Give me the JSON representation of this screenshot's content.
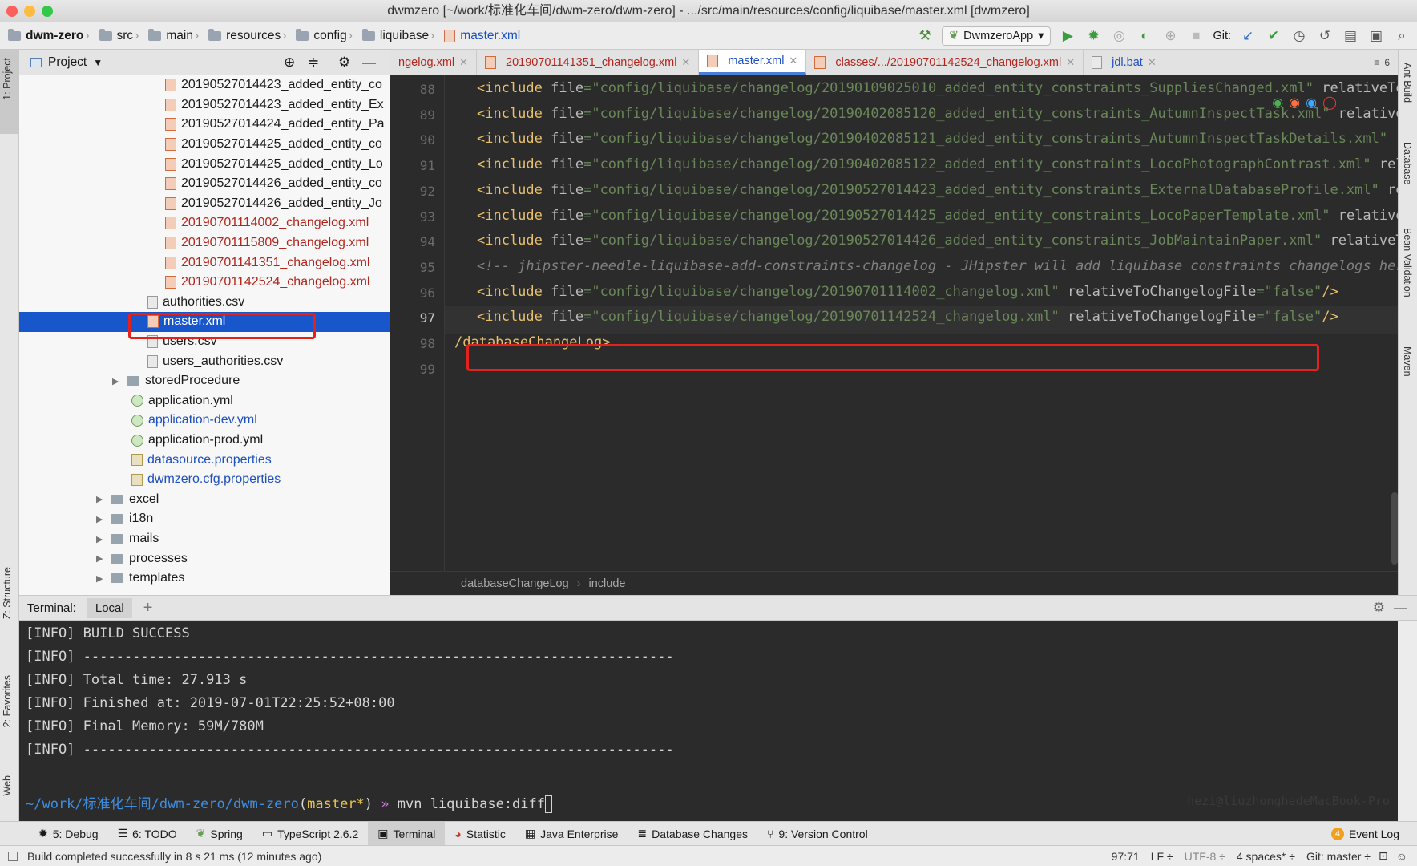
{
  "window": {
    "title": "dwmzero [~/work/标准化车间/dwm-zero/dwm-zero] - .../src/main/resources/config/liquibase/master.xml [dwmzero]"
  },
  "breadcrumb": [
    "dwm-zero",
    "src",
    "main",
    "resources",
    "config",
    "liquibase",
    "master.xml"
  ],
  "toolbar": {
    "run_config": "DwmzeroApp",
    "git_label": "Git:"
  },
  "left_strip": {
    "project": "1: Project",
    "structure": "Z: Structure",
    "favorites": "2: Favorites",
    "web": "Web"
  },
  "right_strip": {
    "ant": "Ant Build",
    "database": "Database",
    "bean": "Bean Validation",
    "maven": "Maven"
  },
  "project_panel": {
    "title": "Project",
    "items": [
      {
        "label": "20190527014423_added_entity_co",
        "kind": "xml",
        "color": "normal"
      },
      {
        "label": "20190527014423_added_entity_Ex",
        "kind": "xml",
        "color": "normal"
      },
      {
        "label": "20190527014424_added_entity_Pa",
        "kind": "xml",
        "color": "normal"
      },
      {
        "label": "20190527014425_added_entity_co",
        "kind": "xml",
        "color": "normal"
      },
      {
        "label": "20190527014425_added_entity_Lo",
        "kind": "xml",
        "color": "normal"
      },
      {
        "label": "20190527014426_added_entity_co",
        "kind": "xml",
        "color": "normal"
      },
      {
        "label": "20190527014426_added_entity_Jo",
        "kind": "xml",
        "color": "normal"
      },
      {
        "label": "20190701114002_changelog.xml",
        "kind": "xml",
        "color": "red"
      },
      {
        "label": "20190701115809_changelog.xml",
        "kind": "xml",
        "color": "red"
      },
      {
        "label": "20190701141351_changelog.xml",
        "kind": "xml",
        "color": "red"
      },
      {
        "label": "20190701142524_changelog.xml",
        "kind": "xml",
        "color": "red"
      },
      {
        "label": "authorities.csv",
        "kind": "csv",
        "color": "normal"
      },
      {
        "label": "master.xml",
        "kind": "xml",
        "color": "selected"
      },
      {
        "label": "users.csv",
        "kind": "csv",
        "color": "normal"
      },
      {
        "label": "users_authorities.csv",
        "kind": "csv",
        "color": "normal"
      },
      {
        "label": "storedProcedure",
        "kind": "folder",
        "color": "normal"
      },
      {
        "label": "application.yml",
        "kind": "yml",
        "color": "normal"
      },
      {
        "label": "application-dev.yml",
        "kind": "yml",
        "color": "blue"
      },
      {
        "label": "application-prod.yml",
        "kind": "yml",
        "color": "normal"
      },
      {
        "label": "datasource.properties",
        "kind": "prop",
        "color": "blue"
      },
      {
        "label": "dwmzero.cfg.properties",
        "kind": "prop",
        "color": "blue"
      },
      {
        "label": "excel",
        "kind": "folder",
        "color": "normal"
      },
      {
        "label": "i18n",
        "kind": "folder",
        "color": "normal"
      },
      {
        "label": "mails",
        "kind": "folder",
        "color": "normal"
      },
      {
        "label": "processes",
        "kind": "folder",
        "color": "normal"
      },
      {
        "label": "templates",
        "kind": "folder",
        "color": "normal"
      }
    ]
  },
  "tabs": [
    {
      "label": "ngelog.xml",
      "active": false
    },
    {
      "label": "20190701141351_changelog.xml",
      "active": false
    },
    {
      "label": "master.xml",
      "active": true
    },
    {
      "label": "classes/.../20190701142524_changelog.xml",
      "active": false
    },
    {
      "label": "jdl.bat",
      "active": false
    }
  ],
  "tab_overflow": "6",
  "editor": {
    "line_numbers": [
      "88",
      "89",
      "90",
      "91",
      "92",
      "93",
      "94",
      "95",
      "96",
      "97",
      "98",
      "99"
    ],
    "current_line": "97",
    "lines": [
      {
        "type": "include",
        "file": "config/liquibase/changelog/20190109025010_added_entity_constraints_SuppliesChanged.xml",
        "attr": "relativeToChan"
      },
      {
        "type": "include",
        "file": "config/liquibase/changelog/20190402085120_added_entity_constraints_AutumnInspectTask.xml",
        "attr": "relativeToCh"
      },
      {
        "type": "include",
        "file": "config/liquibase/changelog/20190402085121_added_entity_constraints_AutumnInspectTaskDetails.xml",
        "attr": "rela"
      },
      {
        "type": "include",
        "file": "config/liquibase/changelog/20190402085122_added_entity_constraints_LocoPhotographContrast.xml",
        "attr": "relativ"
      },
      {
        "type": "include",
        "file": "config/liquibase/changelog/20190527014423_added_entity_constraints_ExternalDatabaseProfile.xml",
        "attr": "relati"
      },
      {
        "type": "include",
        "file": "config/liquibase/changelog/20190527014425_added_entity_constraints_LocoPaperTemplate.xml",
        "attr": "relativeToCh"
      },
      {
        "type": "include",
        "file": "config/liquibase/changelog/20190527014426_added_entity_constraints_JobMaintainPaper.xml",
        "attr": "relativeToCha"
      },
      {
        "type": "comment",
        "text": "<!-- jhipster-needle-liquibase-add-constraints-changelog - JHipster will add liquibase constraints changelogs here -"
      },
      {
        "type": "include_full",
        "file": "config/liquibase/changelog/20190701114002_changelog.xml",
        "attr": "relativeToChangelogFile",
        "value": "false"
      },
      {
        "type": "include_full",
        "file": "config/liquibase/changelog/20190701142524_changelog.xml",
        "attr": "relativeToChangelogFile",
        "value": "false"
      },
      {
        "type": "close",
        "text": "/databaseChangeLog>"
      },
      {
        "type": "empty",
        "text": ""
      }
    ],
    "breadcrumb": [
      "databaseChangeLog",
      "include"
    ]
  },
  "terminal": {
    "label": "Terminal:",
    "tab": "Local",
    "lines": [
      "[INFO] BUILD SUCCESS",
      "[INFO] ------------------------------------------------------------------------",
      "[INFO] Total time: 27.913 s",
      "[INFO] Finished at: 2019-07-01T22:25:52+08:00",
      "[INFO] Final Memory: 59M/780M",
      "[INFO] ------------------------------------------------------------------------"
    ],
    "prompt_path": "~/work/标准化车间/dwm-zero/dwm-zero",
    "prompt_branch": "master*",
    "prompt_arrow": "»",
    "command": "mvn liquibase:diff",
    "right_hint": "hezi@liuzhonghedeMacBook-Pro"
  },
  "bottom_tools": [
    {
      "label": "5: Debug",
      "active": false
    },
    {
      "label": "6: TODO",
      "active": false
    },
    {
      "label": "Spring",
      "active": false
    },
    {
      "label": "TypeScript 2.6.2",
      "active": false
    },
    {
      "label": "Terminal",
      "active": true
    },
    {
      "label": "Statistic",
      "active": false
    },
    {
      "label": "Java Enterprise",
      "active": false
    },
    {
      "label": "Database Changes",
      "active": false
    },
    {
      "label": "9: Version Control",
      "active": false
    }
  ],
  "event_log": {
    "count": "4",
    "label": "Event Log"
  },
  "status": {
    "message": "Build completed successfully in 8 s 21 ms (12 minutes ago)",
    "position": "97:71",
    "line_sep": "LF ÷",
    "encoding": "UTF-8 ÷",
    "indent": "4 spaces* ÷",
    "git": "Git: master ÷"
  },
  "colors": {
    "selection": "#1856cc",
    "highlight_box": "#e2221b",
    "editor_bg": "#2b2b2b",
    "string": "#6a8759",
    "tag": "#e8bf6a"
  }
}
